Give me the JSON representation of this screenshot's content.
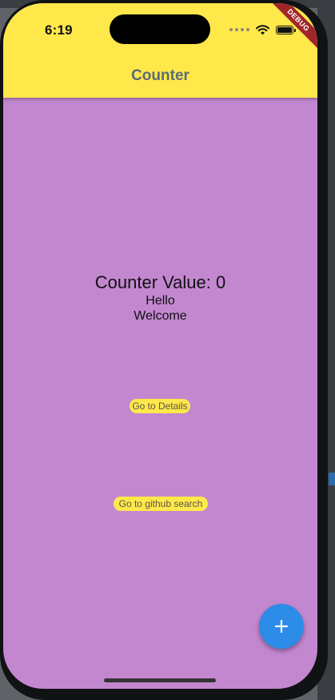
{
  "status_bar": {
    "time": "6:19"
  },
  "app_bar": {
    "title": "Counter",
    "debug_banner": "DEBUG"
  },
  "body": {
    "counter_text": "Counter Value: 0",
    "line1": "Hello",
    "line2": "Welcome",
    "details_button": "Go to Details",
    "github_button": "Go to github search"
  },
  "fab": {
    "icon": "add-icon",
    "symbol": "+"
  },
  "colors": {
    "app_bar": "#ffe84a",
    "background": "#c387d0",
    "fab": "#2c8ce8",
    "debug": "#a0262a"
  }
}
